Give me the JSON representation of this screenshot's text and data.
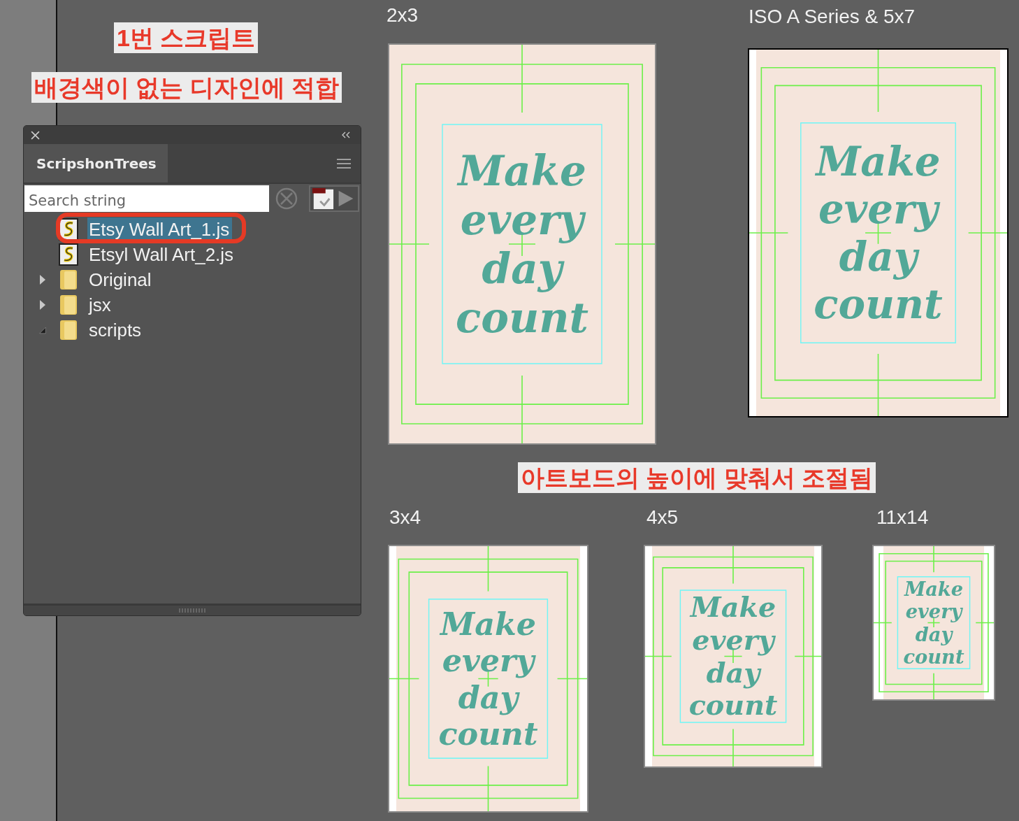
{
  "annotations": [
    {
      "text": "1번 스크립트"
    },
    {
      "text": "배경색이 없는 디자인에 적합"
    },
    {
      "text": "아트보드의 높이에 맞춰서 조절됨"
    }
  ],
  "panel": {
    "tab": {
      "label": "ScripshonTrees",
      "selected": true
    },
    "search": {
      "placeholder": "Search string"
    },
    "tree": [
      {
        "name": "Etsy Wall Art_1.js",
        "kind": "script",
        "selected": true
      },
      {
        "name": "Etsyl Wall Art_2.js",
        "kind": "script",
        "selected": false
      },
      {
        "name": "Original",
        "kind": "folder",
        "selected": false,
        "expanded": false
      },
      {
        "name": "jsx",
        "kind": "folder",
        "selected": false,
        "expanded": false
      },
      {
        "name": "scripts",
        "kind": "folder",
        "selected": false,
        "expanded": true
      }
    ]
  },
  "artboards": [
    {
      "label": "2x3",
      "lines": [
        "Make",
        "every",
        "day",
        "count"
      ]
    },
    {
      "label": "ISO A Series & 5x7",
      "lines": [
        "Make",
        "every",
        "day",
        "count"
      ]
    },
    {
      "label": "3x4",
      "lines": [
        "Make",
        "every",
        "day",
        "count"
      ]
    },
    {
      "label": "4x5",
      "lines": [
        "Make",
        "every",
        "day",
        "count"
      ]
    },
    {
      "label": "11x14",
      "lines": [
        "Make",
        "every",
        "day",
        "count"
      ]
    }
  ]
}
